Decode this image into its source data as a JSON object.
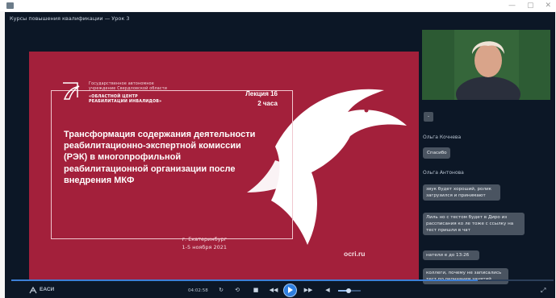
{
  "window": {
    "title": "Курсы повышения квалификации — Урок 3",
    "controls": [
      "—",
      "▢",
      "✕"
    ]
  },
  "slide": {
    "org_lines": [
      "Государственное автономное",
      "учреждение Свердловской области",
      "«ОБЛАСТНОЙ ЦЕНТР",
      "РЕАБИЛИТАЦИИ ИНВАЛИДОВ»"
    ],
    "lecture_no": "Лекция 16",
    "lecture_hours": "2 часа",
    "title": "Трансформация содержания деятельности реабилитационно-экспертной комиссии (РЭК) в многопрофильной реабилитационной организации после внедрения МКФ",
    "city": "г. Екатеринбург",
    "dates": "1-5 ноября 2021",
    "site": "ocri.ru",
    "colors": {
      "background": "#a3203b",
      "accent": "#ffffff"
    }
  },
  "chat": {
    "pill_button": "-",
    "entries": [
      {
        "author": "Ольга Кочнева",
        "messages": [
          "Спасибо"
        ]
      },
      {
        "author": "Ольга Антонова",
        "messages": [
          "звук будет хороший, ролик загрузился и принимают",
          "Лиль но с тестом будет в Диро из рассписания ко ле тоже с ссылку на тест пришли в чат",
          "натели е до 13:26",
          "коллеги, почему не записались тест по окончании занятий"
        ]
      }
    ]
  },
  "player": {
    "progress_fraction": 0.86,
    "time": "04:02:58",
    "brand": "ЕАСИ",
    "volume_fraction": 0.45,
    "buttons": [
      "speed-button",
      "replay-button",
      "stop-button",
      "rewind-button",
      "play-button",
      "forward-button",
      "volume-button",
      "fullscreen-button"
    ]
  }
}
